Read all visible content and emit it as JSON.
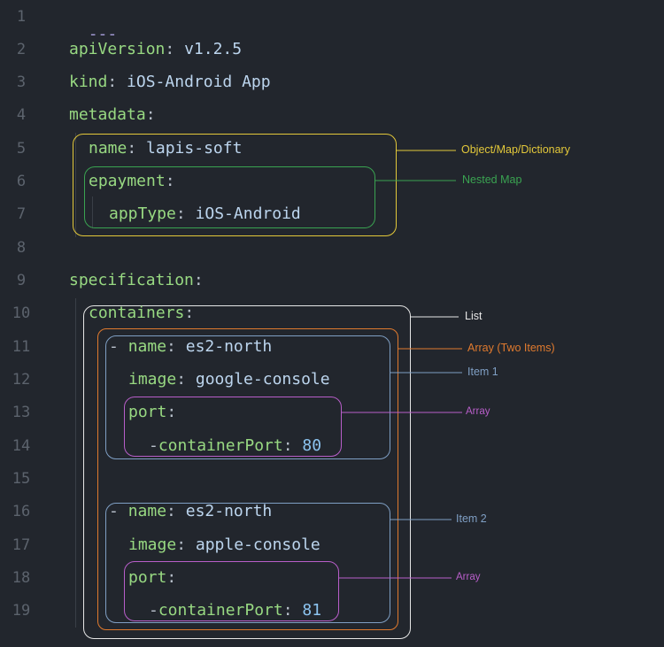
{
  "line_numbers": [
    "1",
    "2",
    "3",
    "4",
    "5",
    "6",
    "7",
    "8",
    "9",
    "10",
    "11",
    "12",
    "13",
    "14",
    "15",
    "16",
    "17",
    "18",
    "19"
  ],
  "yaml": {
    "l1_dashes": "---",
    "l2_key": "apiVersion",
    "l2_val": "v1.2.5",
    "l3_key": "kind",
    "l3_val": "iOS-Android App",
    "l4_key": "metadata",
    "l5_key": "name",
    "l5_val": "lapis-soft",
    "l6_key": "epayment",
    "l7_key": "appType",
    "l7_val": "iOS-Android",
    "l9_key": "specification",
    "l10_key": "containers",
    "l11_dash": "-",
    "l11_key": "name",
    "l11_val": "es2-north",
    "l12_key": "image",
    "l12_val": "google-console",
    "l13_key": "port",
    "l14_dash": "-",
    "l14_key": "containerPort",
    "l14_val": "80",
    "l16_dash": "-",
    "l16_key": "name",
    "l16_val": "es2-north",
    "l17_key": "image",
    "l17_val": "apple-console",
    "l18_key": "port",
    "l19_dash": "-",
    "l19_key": "containerPort",
    "l19_val": "81",
    "colon": ":"
  },
  "annotations": {
    "object_map": "Object/Map/Dictionary",
    "nested_map": "Nested Map",
    "list": "List",
    "array_two": "Array (Two Items)",
    "item1": "Item 1",
    "array1": "Array",
    "item2": "Item 2",
    "array2": "Array"
  },
  "colors": {
    "background": "#22262d",
    "object_map": "#e3c83a",
    "nested_map": "#3aa351",
    "list": "#e6e6e6",
    "array_two": "#e07a2e",
    "item": "#7f9fc4",
    "array": "#b85ec9"
  }
}
